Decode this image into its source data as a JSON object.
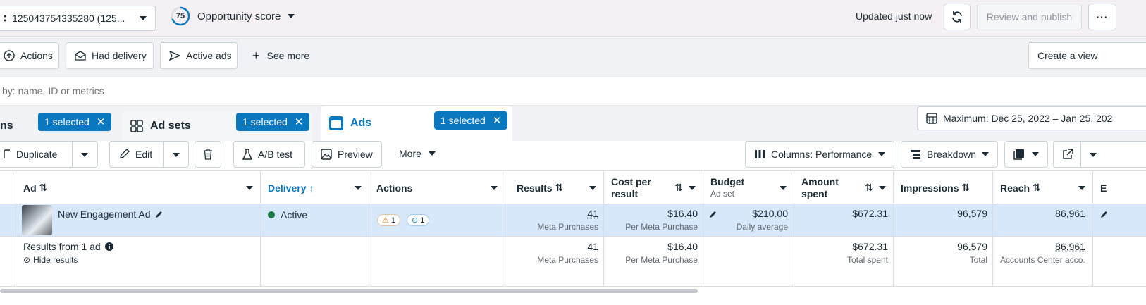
{
  "topbar": {
    "account_label": "125043754335280 (125...",
    "score_value": "75",
    "score_label": "Opportunity score",
    "updated_text": "Updated just now",
    "review_publish_label": "Review and publish"
  },
  "filters": {
    "items": [
      "Actions",
      "Had delivery",
      "Active ads"
    ],
    "see_more": "See more",
    "create_view": "Create a view"
  },
  "search": {
    "placeholder": "by: name, ID or metrics"
  },
  "tabs": {
    "campaigns_partial": "ns",
    "campaigns_selected": "1 selected",
    "adsets_label": "Ad sets",
    "adsets_selected": "1 selected",
    "ads_label": "Ads",
    "ads_selected": "1 selected",
    "date_range": "Maximum: Dec 25, 2022 – Jan 25, 202"
  },
  "toolbar": {
    "duplicate": "Duplicate",
    "edit": "Edit",
    "ab_test": "A/B test",
    "preview": "Preview",
    "more": "More",
    "columns": "Columns: Performance",
    "breakdown": "Breakdown"
  },
  "table": {
    "headers": {
      "ad": "Ad",
      "delivery": "Delivery",
      "actions": "Actions",
      "results": "Results",
      "cost_per_result_1": "Cost per",
      "cost_per_result_2": "result",
      "budget": "Budget",
      "budget_sub": "Ad set",
      "amount_spent_1": "Amount",
      "amount_spent_2": "spent",
      "impressions": "Impressions",
      "reach": "Reach",
      "next_partial": "E"
    },
    "row": {
      "ad_name": "New Engagement Ad",
      "delivery": "Active",
      "warn_count": "1",
      "info_count": "1",
      "results": "41",
      "results_sub": "Meta Purchases",
      "cost": "$16.40",
      "cost_sub": "Per Meta Purchase",
      "budget": "$210.00",
      "budget_sub": "Daily average",
      "amount_spent": "$672.31",
      "impressions": "96,579",
      "reach": "86,961"
    },
    "summary": {
      "label": "Results from 1 ad",
      "hide": "Hide results",
      "results": "41",
      "results_sub": "Meta Purchases",
      "cost": "$16.40",
      "cost_sub": "Per Meta Purchase",
      "amount_spent": "$672.31",
      "amount_sub": "Total spent",
      "impressions": "96,579",
      "impressions_sub": "Total",
      "reach": "86,961",
      "reach_sub": "Accounts Center acco..."
    }
  },
  "colors": {
    "accent": "#0a78be",
    "active_green": "#1d7a47",
    "row_selected": "#d8e8fb"
  }
}
